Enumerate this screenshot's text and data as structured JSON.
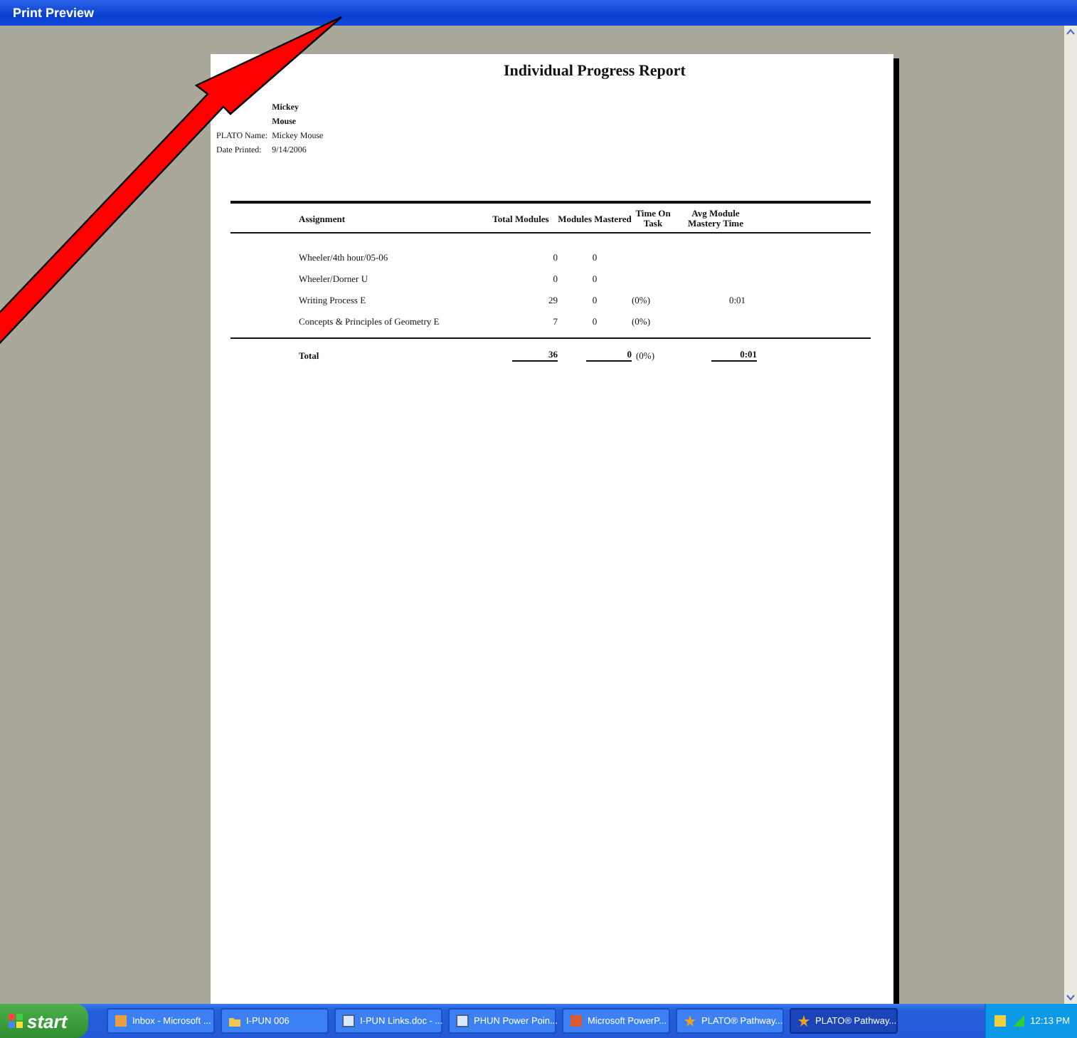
{
  "window": {
    "title": "Print Preview"
  },
  "report": {
    "title": "Individual Progress Report",
    "student": [
      {
        "value": "Mickey",
        "bold": true
      },
      {
        "value": "Mouse",
        "bold": true
      },
      {
        "label": "PLATO Name:",
        "value": "Mickey Mouse",
        "bold": false
      },
      {
        "label": "Date Printed:",
        "value": "9/14/2006",
        "bold": false
      }
    ],
    "columns": [
      "Assignment",
      "Total Modules",
      "Modules Mastered",
      "Time On Task",
      "Avg Module Mastery Time"
    ],
    "rows": [
      {
        "assignment": "Wheeler/4th hour/05-06",
        "total": "0",
        "mastered": "0",
        "percent": "",
        "time": ""
      },
      {
        "assignment": "Wheeler/Dorner U",
        "total": "0",
        "mastered": "0",
        "percent": "",
        "time": ""
      },
      {
        "assignment": "Writing Process E",
        "total": "29",
        "mastered": "0",
        "percent": "(0%)",
        "time": "0:01"
      },
      {
        "assignment": "Concepts & Principles of Geometry E",
        "total": "7",
        "mastered": "0",
        "percent": "(0%)",
        "time": ""
      }
    ],
    "total": {
      "label": "Total",
      "total": "36",
      "mastered": "0",
      "percent": "(0%)",
      "time": "0:01"
    }
  },
  "taskbar": {
    "start": "start",
    "tasks": [
      {
        "label": "Inbox - Microsoft ...",
        "selected": false,
        "kind": "mail"
      },
      {
        "label": "I-PUN 006",
        "selected": false,
        "kind": "folder"
      },
      {
        "label": "I-PUN Links.doc - ...",
        "selected": false,
        "kind": "doc"
      },
      {
        "label": "PHUN Power Poin...",
        "selected": false,
        "kind": "doc"
      },
      {
        "label": "Microsoft PowerP...",
        "selected": false,
        "kind": "ppt"
      },
      {
        "label": "PLATO® Pathway...",
        "selected": false,
        "kind": "plato"
      },
      {
        "label": "PLATO® Pathway...",
        "selected": true,
        "kind": "plato"
      }
    ],
    "clock": "12:13 PM"
  }
}
